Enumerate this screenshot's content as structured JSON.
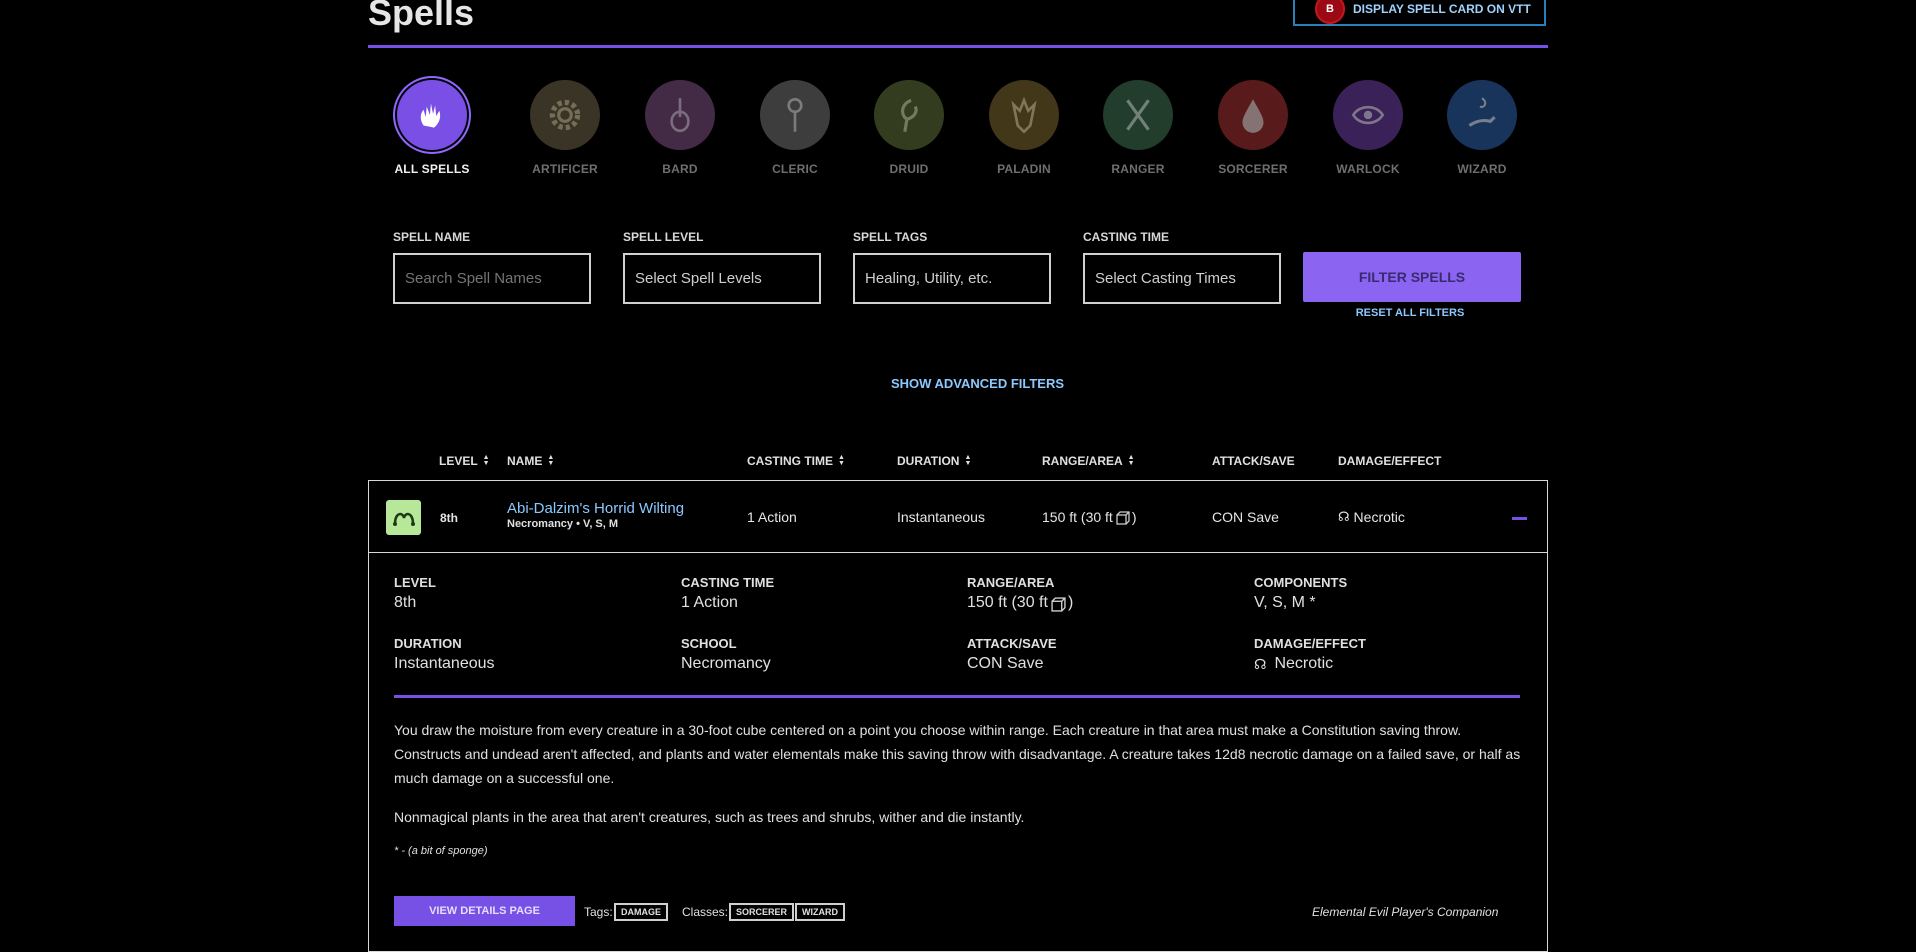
{
  "page": {
    "title": "Spells"
  },
  "vtt_button": {
    "label": "DISPLAY SPELL CARD ON VTT",
    "badge": "B"
  },
  "classes": [
    {
      "label": "ALL SPELLS",
      "icon": "hand-flame-icon",
      "color": "#7a4fe6"
    },
    {
      "label": "ARTIFICER",
      "icon": "gear-icon",
      "color": "#6b5f45"
    },
    {
      "label": "BARD",
      "icon": "lute-icon",
      "color": "#7a4f7f"
    },
    {
      "label": "CLERIC",
      "icon": "mace-icon",
      "color": "#707070"
    },
    {
      "label": "DRUID",
      "icon": "leaf-icon",
      "color": "#5f6d3a"
    },
    {
      "label": "PALADIN",
      "icon": "helm-icon",
      "color": "#7a6530"
    },
    {
      "label": "RANGER",
      "icon": "crossed-blades-icon",
      "color": "#3f7050"
    },
    {
      "label": "SORCERER",
      "icon": "blood-drop-icon",
      "color": "#a13030"
    },
    {
      "label": "WARLOCK",
      "icon": "eye-icon",
      "color": "#6b3fa0"
    },
    {
      "label": "WIZARD",
      "icon": "wizard-hand-icon",
      "color": "#2f5fa6"
    }
  ],
  "filters": {
    "spell_name": {
      "label": "SPELL NAME",
      "placeholder": "Search Spell Names"
    },
    "spell_level": {
      "label": "SPELL LEVEL",
      "placeholder": "Select Spell Levels"
    },
    "spell_tags": {
      "label": "SPELL TAGS",
      "placeholder": "Healing, Utility, etc."
    },
    "casting_time": {
      "label": "CASTING TIME",
      "placeholder": "Select Casting Times"
    },
    "filter_button": "FILTER SPELLS",
    "reset_link": "RESET ALL FILTERS",
    "advanced_link": "SHOW ADVANCED FILTERS"
  },
  "table": {
    "headers": {
      "level": "LEVEL",
      "name": "NAME",
      "casting_time": "CASTING TIME",
      "duration": "DURATION",
      "range": "RANGE/AREA",
      "attack": "ATTACK/SAVE",
      "damage": "DAMAGE/EFFECT"
    },
    "row": {
      "level": "8th",
      "name": "Abi-Dalzim's Horrid Wilting",
      "subtitle": "Necromancy • V, S, M",
      "casting_time": "1 Action",
      "duration": "Instantaneous",
      "range": "150 ft (30 ft",
      "range_close": ")",
      "attack": "CON Save",
      "damage": "Necrotic"
    }
  },
  "details": {
    "level": {
      "label": "LEVEL",
      "value": "8th"
    },
    "casting_time": {
      "label": "CASTING TIME",
      "value": "1 Action"
    },
    "range": {
      "label": "RANGE/AREA",
      "value": "150 ft (30 ft",
      "close": ")"
    },
    "components": {
      "label": "COMPONENTS",
      "value": "V, S, M *"
    },
    "duration": {
      "label": "DURATION",
      "value": "Instantaneous"
    },
    "school": {
      "label": "SCHOOL",
      "value": "Necromancy"
    },
    "attack": {
      "label": "ATTACK/SAVE",
      "value": "CON Save"
    },
    "damage": {
      "label": "DAMAGE/EFFECT",
      "value": "Necrotic"
    },
    "description_1": "You draw the moisture from every creature in a 30-foot cube centered on a point you choose within range. Each creature in that area must make a Constitution saving throw. Constructs and undead aren't affected, and plants and water elementals make this saving throw with disadvantage. A creature takes 12d8 necrotic damage on a failed save, or half as much damage on a successful one.",
    "description_2": "Nonmagical plants in the area that aren't creatures, such as trees and shrubs, wither and die instantly.",
    "footnote": "* - (a bit of sponge)",
    "details_button": "VIEW DETAILS PAGE",
    "tags_label": "Tags:",
    "tags": [
      "DAMAGE"
    ],
    "classes_label": "Classes:",
    "classes": [
      "SORCERER",
      "WIZARD"
    ],
    "source": "Elemental Evil Player's Companion"
  },
  "colors": {
    "accent": "#7750e6",
    "link": "#8cc8ff",
    "school_necromancy": "#b7e89a"
  }
}
